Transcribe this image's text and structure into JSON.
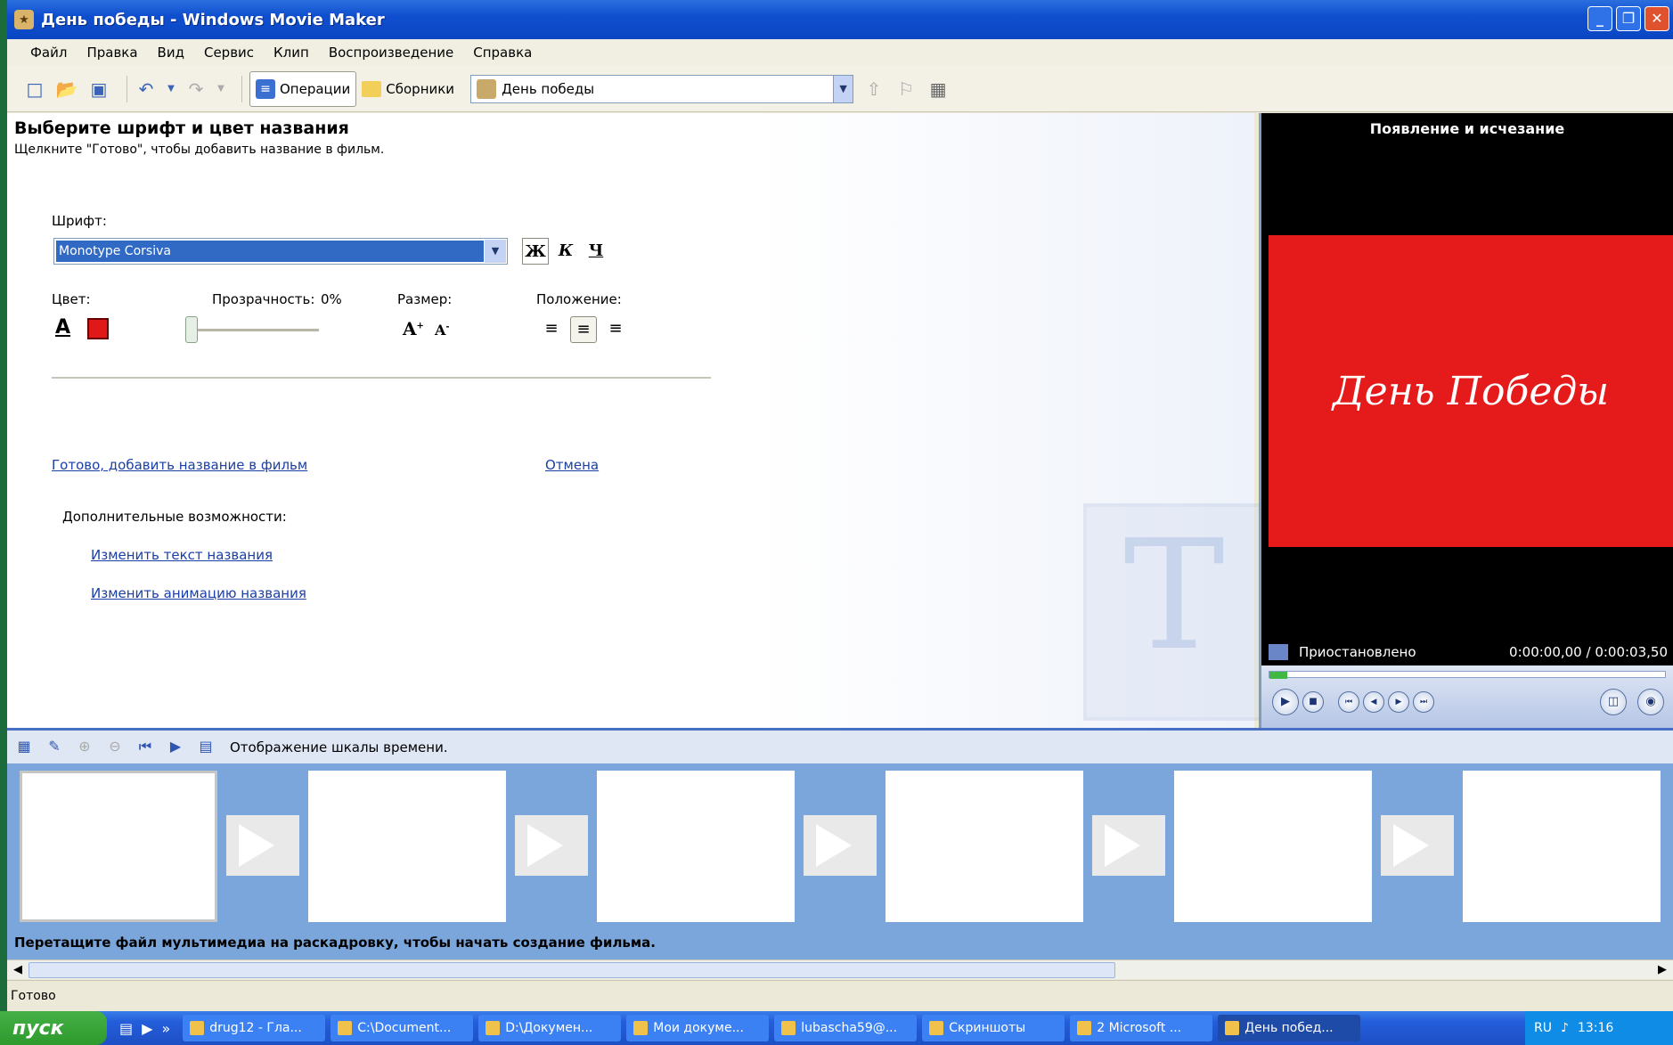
{
  "window": {
    "title": "День победы - Windows Movie Maker"
  },
  "menu": [
    "Файл",
    "Правка",
    "Вид",
    "Сервис",
    "Клип",
    "Воспроизведение",
    "Справка"
  ],
  "toolbar": {
    "operations": "Операции",
    "collections": "Сборники",
    "collection_name": "День победы"
  },
  "task": {
    "heading": "Выберите шрифт и цвет названия",
    "subheading": "Щелкните \"Готово\", чтобы добавить название в фильм.",
    "font_label": "Шрифт:",
    "font_value": "Monotype Corsiva",
    "bold": "Ж",
    "italic": "К",
    "underline": "Ч",
    "color_label": "Цвет:",
    "transparency_label": "Прозрачность:",
    "transparency_value": "0%",
    "size_label": "Размер:",
    "position_label": "Положение:",
    "done_link": "Готово, добавить название в фильм",
    "cancel_link": "Отмена",
    "more_label": "Дополнительные возможности:",
    "change_text_link": "Изменить текст названия",
    "change_anim_link": "Изменить анимацию названия",
    "text_color": "#e01818",
    "transparency_fraction": 0
  },
  "preview": {
    "title": "Появление и исчезание",
    "caption": "День Победы",
    "status": "Приостановлено",
    "time": "0:00:00,00 / 0:00:03,50",
    "background_color": "#e51a1a"
  },
  "storyboard": {
    "toggle_label": "Отображение шкалы времени.",
    "hint": "Перетащите файл мультимедиа на раскадровку, чтобы начать создание фильма."
  },
  "status_bar": "Готово",
  "taskbar": {
    "start": "пуск",
    "buttons": [
      "drug12 - Гла...",
      "C:\\Document...",
      "D:\\Докумен...",
      "Мои докуме...",
      "lubascha59@...",
      "Скриншоты",
      "2 Microsoft ...",
      "День побед..."
    ],
    "lang": "RU",
    "clock": "13:16"
  }
}
